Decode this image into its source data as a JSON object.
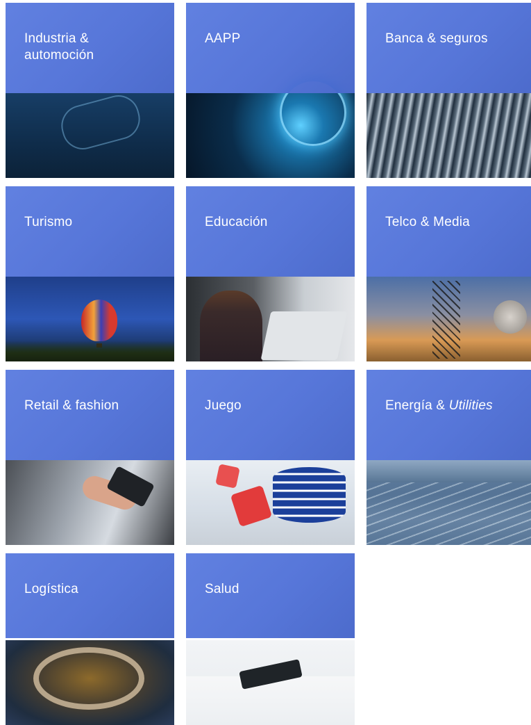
{
  "tiles": [
    {
      "label": "Industria &",
      "label2": "automoción"
    },
    {
      "label": "AAPP"
    },
    {
      "label": "Banca & seguros"
    },
    {
      "label": "Turismo"
    },
    {
      "label": "Educación"
    },
    {
      "label": "Telco & Media"
    },
    {
      "label": "Retail & fashion"
    },
    {
      "label": "Juego"
    },
    {
      "label": "Energía & ",
      "label_italic": "Utilities"
    },
    {
      "label": "Logística"
    },
    {
      "label": "Salud"
    }
  ],
  "colors": {
    "band": "#4a6cd6",
    "text": "#ffffff",
    "background": "#ffffff"
  }
}
